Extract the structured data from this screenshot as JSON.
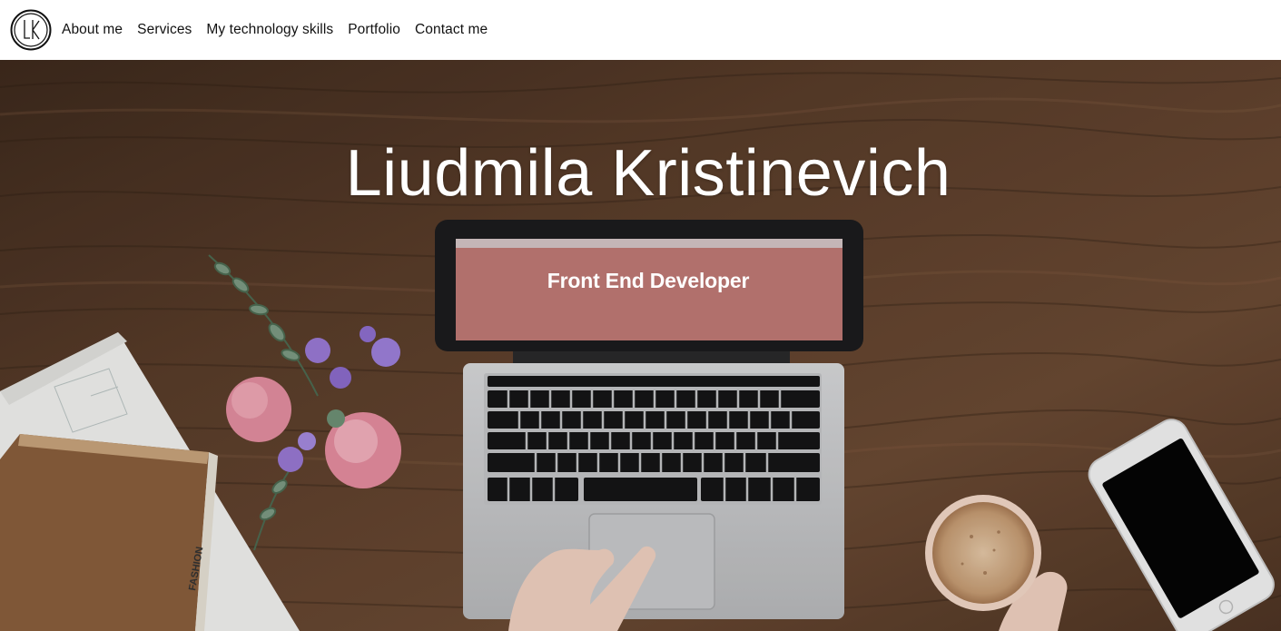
{
  "navbar": {
    "logo_icon": "lk-monogram-logo",
    "links": [
      {
        "label": "About me"
      },
      {
        "label": "Services"
      },
      {
        "label": "My technology skills"
      },
      {
        "label": "Portfolio"
      },
      {
        "label": "Contact me"
      }
    ]
  },
  "hero": {
    "title": "Liudmila Kristinevich",
    "subtitle": "Front End Developer",
    "background_image": "wooden-desk-laptop-flowers-coffee-phone",
    "screen_color": "#c07a76"
  },
  "colors": {
    "wood_dark": "#4a3222",
    "wood_mid": "#6b4a33",
    "text_white": "#ffffff"
  }
}
